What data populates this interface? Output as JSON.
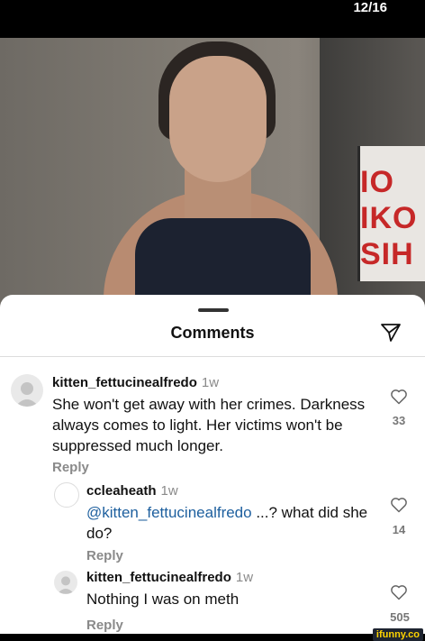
{
  "story": {
    "counter": "12/16"
  },
  "photo": {
    "sign_text": "IO\nIKO\nSIH"
  },
  "sheet": {
    "title": "Comments"
  },
  "comments": [
    {
      "username": "kitten_fettucinealfredo",
      "time": "1w",
      "text": "She won't get away with her crimes. Darkness always comes to light. Her victims won't be suppressed much longer.",
      "reply_label": "Reply",
      "likes": "33"
    },
    {
      "username": "ccleaheath",
      "time": "1w",
      "mention": "@kitten_fettucinealfredo",
      "text": " ...? what did she do?",
      "reply_label": "Reply",
      "likes": "14"
    },
    {
      "username": "kitten_fettucinealfredo",
      "time": "1w",
      "text": "Nothing I was on meth",
      "reply_label": "Reply",
      "likes": "505"
    }
  ],
  "watermark": {
    "text": "ifunny.co"
  },
  "colors": {
    "mention": "#1d5f9e",
    "watermark_bg": "#1e2430",
    "watermark_fg": "#ffd400"
  }
}
